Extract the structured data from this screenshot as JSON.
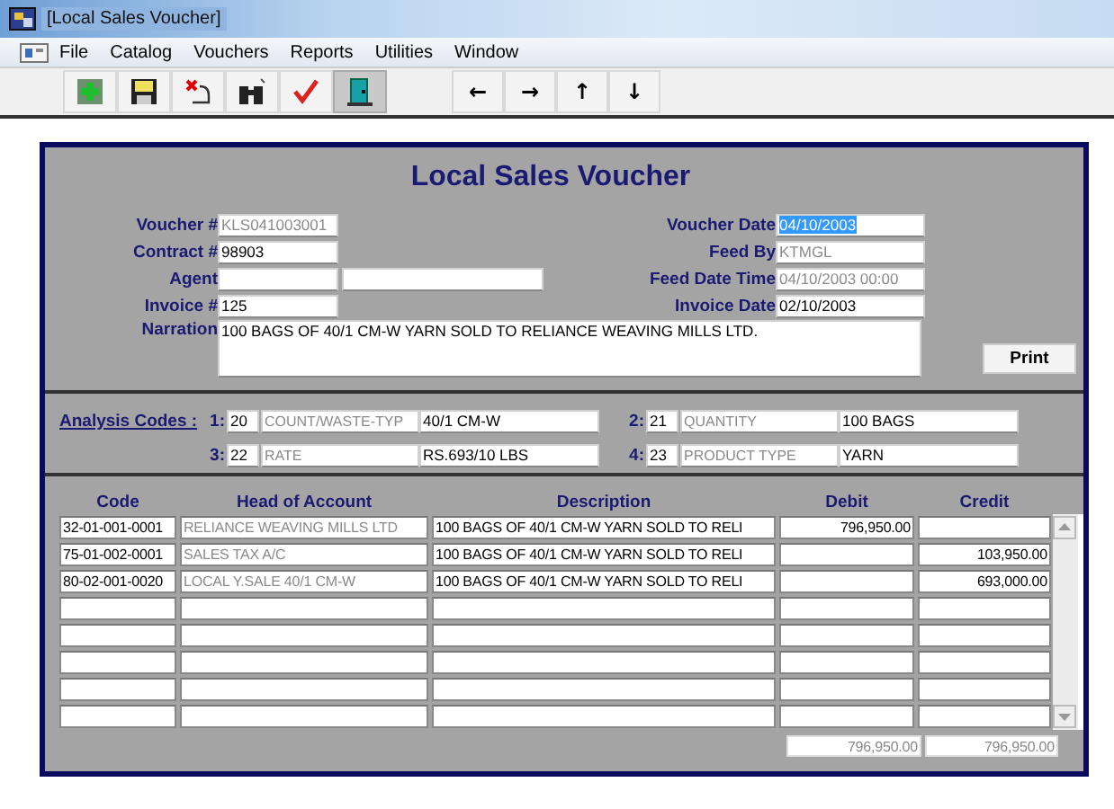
{
  "window": {
    "title": "[Local Sales Voucher]"
  },
  "menu": [
    "File",
    "Catalog",
    "Vouchers",
    "Reports",
    "Utilities",
    "Window"
  ],
  "toolbar": [
    {
      "kind": "add",
      "pressed": false
    },
    {
      "kind": "save",
      "pressed": false
    },
    {
      "kind": "cancel",
      "pressed": false
    },
    {
      "kind": "find",
      "pressed": false
    },
    {
      "kind": "confirm",
      "pressed": false
    },
    {
      "kind": "exit",
      "pressed": true
    }
  ],
  "nav_buttons": [
    "←",
    "→",
    "↑",
    "↓"
  ],
  "form": {
    "title": "Local Sales Voucher",
    "left_fields": [
      {
        "label": "Voucher #",
        "value": "KLS041003001",
        "readonly": true
      },
      {
        "label": "Contract #",
        "value": "98903",
        "readonly": false
      },
      {
        "label": "Agent",
        "extra_field": true
      },
      {
        "label": "Invoice #",
        "value": "125",
        "readonly": false
      }
    ],
    "right_fields": [
      {
        "label": "Voucher Date",
        "value": "04/10/2003",
        "readonly": false,
        "highlighted": true
      },
      {
        "label": "Feed By",
        "value": "KTMGL",
        "readonly": true,
        "highlighted": false
      },
      {
        "label": "Feed Date Time",
        "value": "04/10/2003 00:00",
        "readonly": true,
        "highlighted": false
      },
      {
        "label": "Invoice Date",
        "value": "02/10/2003",
        "readonly": false,
        "highlighted": false
      }
    ],
    "narration": {
      "label": "Narration",
      "value": "100 BAGS OF 40/1 CM-W  YARN SOLD TO RELIANCE WEAVING MILLS LTD."
    },
    "print_button": "Print"
  },
  "analysis": {
    "link": "Analysis Codes :",
    "codes": [
      {
        "index": "1:",
        "code": "20",
        "name": "COUNT/WASTE-TYP",
        "value": "40/1 CM-W"
      },
      {
        "index": "2:",
        "code": "21",
        "name": "QUANTITY",
        "value": "100 BAGS"
      },
      {
        "index": "3:",
        "code": "22",
        "name": "RATE",
        "value": "RS.693/10 LBS"
      },
      {
        "index": "4:",
        "code": "23",
        "name": "PRODUCT TYPE",
        "value": "YARN"
      }
    ]
  },
  "table": {
    "columns": [
      "Code",
      "Head of Account",
      "Description",
      "Debit",
      "Credit"
    ],
    "rows": [
      {
        "code": "32-01-001-0001",
        "head_of_account": "RELIANCE WEAVING MILLS LTD",
        "description": "100 BAGS OF 40/1 CM-W  YARN SOLD TO RELI",
        "debit": "796,950.00"
      },
      {
        "code": "75-01-002-0001",
        "head_of_account": "SALES TAX A/C",
        "description": "100 BAGS OF 40/1 CM-W  YARN SOLD TO RELI",
        "credit": "103,950.00"
      },
      {
        "code": "80-02-001-0020",
        "head_of_account": "LOCAL Y.SALE  40/1 CM-W",
        "description": "100 BAGS OF 40/1 CM-W  YARN SOLD TO RELI",
        "credit": "693,000.00"
      }
    ],
    "totals": {
      "debit": "796,950.00",
      "credit": "796,950.00"
    }
  }
}
